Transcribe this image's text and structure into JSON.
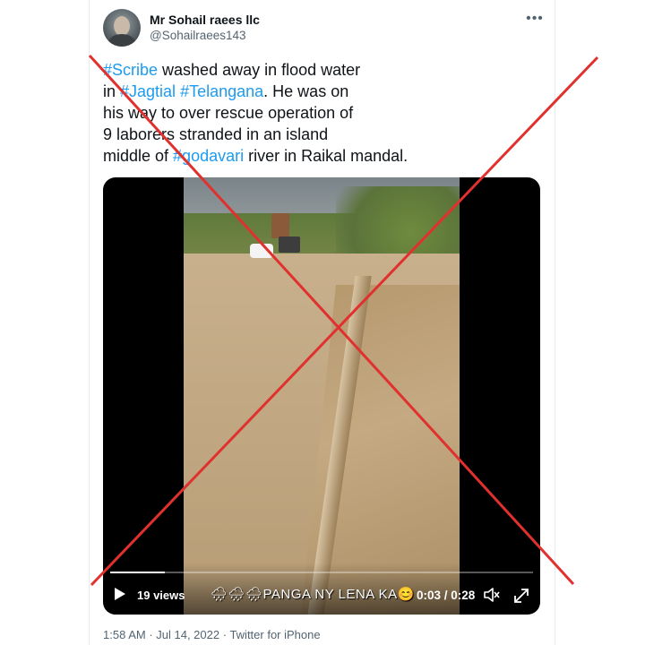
{
  "tweet": {
    "display_name": "Mr Sohail raees llc",
    "handle": "@Sohailraees143",
    "more_icon": "more-horizontal-icon",
    "text_lines": [
      [
        {
          "text": "#Scribe",
          "hashtag": true
        },
        {
          "text": " washed away in flood water",
          "hashtag": false
        }
      ],
      [
        {
          "text": "in ",
          "hashtag": false
        },
        {
          "text": "#Jagtial",
          "hashtag": true
        },
        {
          "text": " ",
          "hashtag": false
        },
        {
          "text": "#Telangana",
          "hashtag": true
        },
        {
          "text": ". He was on",
          "hashtag": false
        }
      ],
      [
        {
          "text": "his way to over rescue operation of",
          "hashtag": false
        }
      ],
      [
        {
          "text": "9 laborers stranded in an island",
          "hashtag": false
        }
      ],
      [
        {
          "text": "middle of ",
          "hashtag": false
        },
        {
          "text": "#godavari",
          "hashtag": true
        },
        {
          "text": " river in Raikal mandal.",
          "hashtag": false
        }
      ]
    ],
    "footer": {
      "time": "1:58 AM",
      "date": "Jul 14, 2022",
      "source": "Twitter for iPhone",
      "separator": " · "
    }
  },
  "video": {
    "views": "19 views",
    "caption": "🌧🌧🌧PANGA NY LENA KA😊",
    "time_display": "0:03 / 0:28",
    "progress_fraction": 0.13
  },
  "colors": {
    "hashtag": "#1d9bf0",
    "muted_text": "#536471",
    "overlay_cross": "#e0312f"
  }
}
